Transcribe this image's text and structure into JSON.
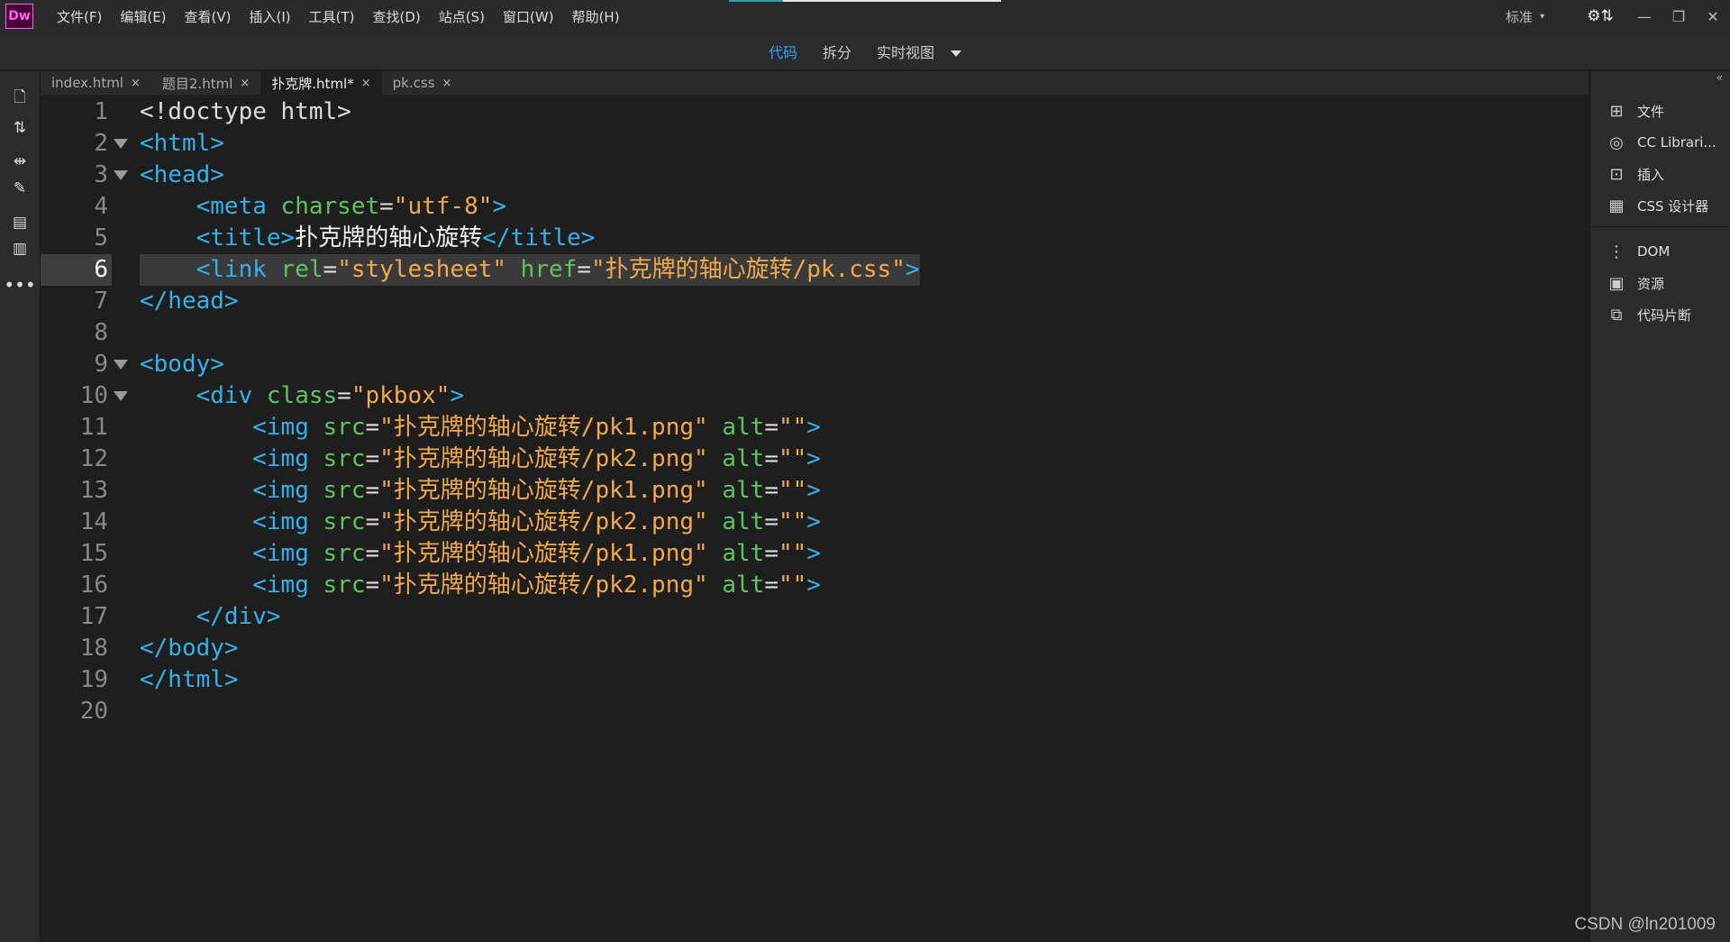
{
  "app": {
    "logo": "Dw",
    "watermark": "CSDN @ln201009"
  },
  "menu": [
    "文件(F)",
    "编辑(E)",
    "查看(V)",
    "插入(I)",
    "工具(T)",
    "查找(D)",
    "站点(S)",
    "窗口(W)",
    "帮助(H)"
  ],
  "workspace": {
    "label": "标准",
    "gear": "⚙⇅"
  },
  "views": {
    "code": "代码",
    "split": "拆分",
    "live": "实时视图"
  },
  "tabs": [
    {
      "label": "index.html",
      "close": "×"
    },
    {
      "label": "题目2.html",
      "close": "×"
    },
    {
      "label": "扑克牌.html*",
      "close": "×"
    },
    {
      "label": "pk.css",
      "close": "×"
    }
  ],
  "panel": {
    "files": "文件",
    "cc": "CC Librari...",
    "insert": "插入",
    "css": "CSS 设计器",
    "dom": "DOM",
    "assets": "资源",
    "snippets": "代码片断"
  },
  "code": {
    "l1": "<!doctype html>",
    "l2": "<html>",
    "l3": "<head>",
    "l4": {
      "tag": "<meta",
      "attr": " charset",
      "eq": "=",
      "val": "\"utf-8\"",
      "end": ">"
    },
    "l5": {
      "open": "<title>",
      "text": "扑克牌的轴心旋转",
      "close": "</title>"
    },
    "l6": {
      "tag": "<link",
      "attr1": " rel",
      "val1": "\"stylesheet\"",
      "attr2": " href",
      "val2": "\"扑克牌的轴心旋转/pk.css\"",
      "end": ">"
    },
    "l7": "</head>",
    "l9": "<body>",
    "l10": {
      "tag": "<div",
      "attr": " class",
      "val": "\"pkbox\"",
      "end": ">"
    },
    "imgs": [
      "\"扑克牌的轴心旋转/pk1.png\"",
      "\"扑克牌的轴心旋转/pk2.png\"",
      "\"扑克牌的轴心旋转/pk1.png\"",
      "\"扑克牌的轴心旋转/pk2.png\"",
      "\"扑克牌的轴心旋转/pk1.png\"",
      "\"扑克牌的轴心旋转/pk2.png\""
    ],
    "img_tag": "<img",
    "img_src": " src",
    "img_alt": " alt",
    "img_alt_val": "\"\"",
    "eq": "=",
    "gt": ">",
    "l17": "</div>",
    "l18": "</body>",
    "l19": "</html>",
    "nums": [
      "1",
      "2",
      "3",
      "4",
      "5",
      "6",
      "7",
      "8",
      "9",
      "10",
      "11",
      "12",
      "13",
      "14",
      "15",
      "16",
      "17",
      "18",
      "19",
      "20"
    ]
  },
  "colors": {
    "tag": "#35b0e8",
    "attr": "#5ec45e",
    "string": "#f1a94b",
    "active_view": "#2fa1ff"
  }
}
